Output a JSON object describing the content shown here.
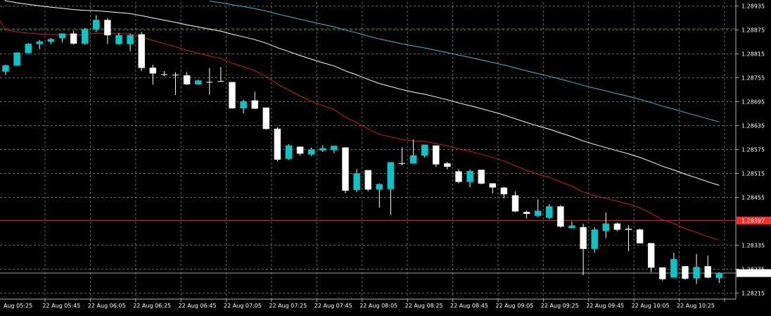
{
  "chart_data": {
    "type": "candlestick",
    "colors": {
      "background": "#000000",
      "grid": "#8a8a8a",
      "bull_fill": "#00c8c8",
      "bear_fill": "#ffffff",
      "wick": "#ffffff",
      "ma_white": "#ffffff",
      "ma_cyan": "#3fb8d0",
      "ma_red": "#cc1a1a",
      "green_level": "#3a7a3a",
      "red_level": "#ff2a2a",
      "current_level": "#9aa0a0"
    },
    "y_ticks": [
      "1.28935",
      "1.28875",
      "1.28815",
      "1.28755",
      "1.28695",
      "1.28635",
      "1.28575",
      "1.28515",
      "1.28455",
      "1.28335",
      "1.28275",
      "1.28215"
    ],
    "x_ticks": [
      "Aug 05:25",
      "22 Aug 05:45",
      "22 Aug 06:05",
      "22 Aug 06:25",
      "22 Aug 06:45",
      "22 Aug 07:05",
      "22 Aug 07:25",
      "22 Aug 07:45",
      "22 Aug 08:05",
      "22 Aug 08:25",
      "22 Aug 08:45",
      "22 Aug 09:05",
      "22 Aug 09:25",
      "22 Aug 09:45",
      "22 Aug 10:05",
      "22 Aug 10:25"
    ],
    "ylim": [
      1.28205,
      1.28945
    ],
    "levels": {
      "red_line": {
        "value": 1.28397,
        "label": "1.28397"
      },
      "green_line": {
        "value": 1.28878
      },
      "current_price": {
        "value": 1.28265,
        "label": "1.28265"
      }
    },
    "candles": [
      [
        1.28771,
        1.28788,
        1.28762,
        1.28786
      ],
      [
        1.28786,
        1.28819,
        1.28785,
        1.28818
      ],
      [
        1.28818,
        1.28842,
        1.28815,
        1.2884
      ],
      [
        1.2884,
        1.2885,
        1.28827,
        1.28846
      ],
      [
        1.28846,
        1.28855,
        1.2884,
        1.28852
      ],
      [
        1.28855,
        1.28862,
        1.28844,
        1.28866
      ],
      [
        1.28866,
        1.28873,
        1.28838,
        1.28841
      ],
      [
        1.28841,
        1.2888,
        1.28838,
        1.28877
      ],
      [
        1.28877,
        1.28912,
        1.2887,
        1.289
      ],
      [
        1.289,
        1.28905,
        1.2884,
        1.28862
      ],
      [
        1.2884,
        1.28868,
        1.28838,
        1.28862
      ],
      [
        1.2884,
        1.28866,
        1.28822,
        1.28862
      ],
      [
        1.28864,
        1.2887,
        1.28772,
        1.2878
      ],
      [
        1.2878,
        1.28788,
        1.28738,
        1.28766
      ],
      [
        1.28763,
        1.28772,
        1.28759,
        1.28762
      ],
      [
        1.28762,
        1.28769,
        1.28712,
        1.28761
      ],
      [
        1.28761,
        1.2877,
        1.28737,
        1.28739
      ],
      [
        1.28739,
        1.2875,
        1.28738,
        1.28748
      ],
      [
        1.28744,
        1.2878,
        1.28713,
        1.28744
      ],
      [
        1.28745,
        1.28782,
        1.28745,
        1.28746
      ],
      [
        1.28744,
        1.28745,
        1.28677,
        1.28679
      ],
      [
        1.28679,
        1.287,
        1.28666,
        1.28696
      ],
      [
        1.28698,
        1.2872,
        1.28677,
        1.28678
      ],
      [
        1.2868,
        1.28681,
        1.28625,
        1.28627
      ],
      [
        1.28627,
        1.28631,
        1.28545,
        1.2855
      ],
      [
        1.28552,
        1.28588,
        1.28549,
        1.28585
      ],
      [
        1.28582,
        1.28582,
        1.2856,
        1.28565
      ],
      [
        1.28563,
        1.2858,
        1.28559,
        1.28575
      ],
      [
        1.28573,
        1.28586,
        1.28569,
        1.28578
      ],
      [
        1.28574,
        1.2858,
        1.28566,
        1.28584
      ],
      [
        1.2858,
        1.28581,
        1.28465,
        1.28472
      ],
      [
        1.28474,
        1.28526,
        1.28468,
        1.28515
      ],
      [
        1.28523,
        1.28523,
        1.2847,
        1.28475
      ],
      [
        1.28475,
        1.2849,
        1.28429,
        1.28488
      ],
      [
        1.28476,
        1.28541,
        1.28411,
        1.28543
      ],
      [
        1.2854,
        1.2858,
        1.28535,
        1.2854
      ],
      [
        1.2854,
        1.286,
        1.2854,
        1.2856
      ],
      [
        1.2856,
        1.28585,
        1.28555,
        1.28587
      ],
      [
        1.28585,
        1.28585,
        1.28531,
        1.28538
      ],
      [
        1.2854,
        1.28544,
        1.28525,
        1.28532
      ],
      [
        1.2852,
        1.28526,
        1.2849,
        1.28494
      ],
      [
        1.28494,
        1.28525,
        1.2848,
        1.28521
      ],
      [
        1.28524,
        1.28524,
        1.28488,
        1.2849
      ],
      [
        1.2849,
        1.2849,
        1.28465,
        1.2848
      ],
      [
        1.28479,
        1.28482,
        1.28452,
        1.28463
      ],
      [
        1.2846,
        1.2847,
        1.28418,
        1.2842
      ],
      [
        1.28418,
        1.28422,
        1.28402,
        1.28414
      ],
      [
        1.28409,
        1.2845,
        1.28406,
        1.28421
      ],
      [
        1.28404,
        1.28438,
        1.284,
        1.28432
      ],
      [
        1.28432,
        1.28436,
        1.28379,
        1.28382
      ],
      [
        1.28378,
        1.28394,
        1.28378,
        1.28384
      ],
      [
        1.2838,
        1.28389,
        1.2826,
        1.28326
      ],
      [
        1.28326,
        1.2838,
        1.28316,
        1.28374
      ],
      [
        1.28371,
        1.28417,
        1.28353,
        1.28389
      ],
      [
        1.28389,
        1.28392,
        1.2837,
        1.28374
      ],
      [
        1.28376,
        1.28385,
        1.2832,
        1.28374
      ],
      [
        1.28374,
        1.28377,
        1.2834,
        1.2834
      ],
      [
        1.2834,
        1.2834,
        1.28267,
        1.28279
      ],
      [
        1.28279,
        1.28279,
        1.28246,
        1.2825
      ],
      [
        1.28254,
        1.28316,
        1.28254,
        1.283
      ],
      [
        1.28282,
        1.28282,
        1.28248,
        1.28251
      ],
      [
        1.28252,
        1.28313,
        1.28238,
        1.2828
      ],
      [
        1.28282,
        1.28309,
        1.28252,
        1.28254
      ],
      [
        1.28253,
        1.28267,
        1.2824,
        1.28265
      ]
    ]
  }
}
